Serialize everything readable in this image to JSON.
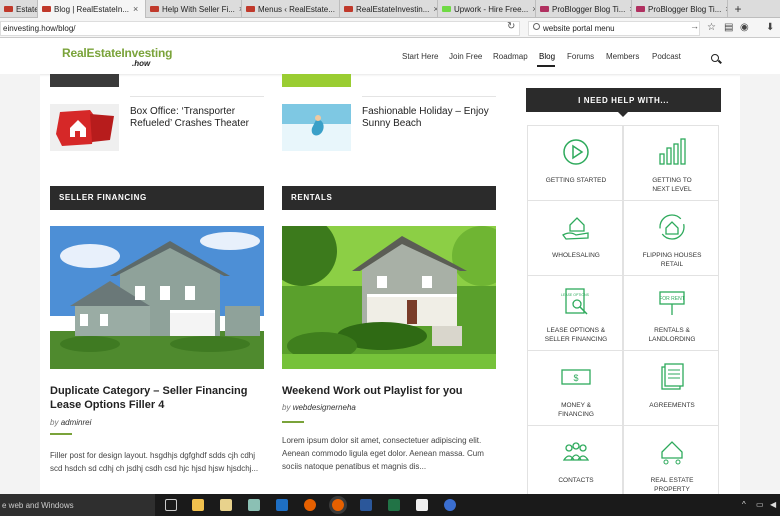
{
  "browser": {
    "tabs": [
      {
        "label": "Estate...",
        "fav": "#c0392b"
      },
      {
        "label": "Blog | RealEstateIn...",
        "fav": "#c0392b",
        "active": true
      },
      {
        "label": "Help With Seller Fi...",
        "fav": "#c0392b"
      },
      {
        "label": "Menus ‹ RealEstate...",
        "fav": "#c0392b"
      },
      {
        "label": "RealEstateInvestin...",
        "fav": "#c0392b"
      },
      {
        "label": "Upwork - Hire Free...",
        "fav": "#6fda44"
      },
      {
        "label": "ProBlogger Blog Ti...",
        "fav": "#b03060"
      },
      {
        "label": "ProBlogger Blog Ti...",
        "fav": "#b03060"
      }
    ],
    "url": "einvesting.how/blog/",
    "search_value": "website portal menu"
  },
  "site": {
    "logo_main": "RealEstateInvesting",
    "logo_sub": ".how",
    "menu": [
      "Start Here",
      "Join Free",
      "Roadmap",
      "Blog",
      "Forums",
      "Members",
      "Podcast"
    ],
    "active_menu": "Blog",
    "brand_color": "#7aa33a"
  },
  "small_posts": [
    {
      "title": "Box Office: ‘Transporter Refueled’ Crashes Theater"
    },
    {
      "title": "Fashionable Holiday – Enjoy Sunny Beach"
    }
  ],
  "sections": [
    {
      "heading": "SELLER FINANCING",
      "post_title": "Duplicate Category – Seller Financing Lease Options Filler 4",
      "by": "by",
      "author": "adminrei",
      "excerpt": "Filler post for design layout.  hsgdhjs dgfghdf sdds cjh cdhj scd hsdch sd cdhj ch jsdhj csdh csd hjc hjsd hjsw hjsdchj..."
    },
    {
      "heading": "RENTALS",
      "post_title": "Weekend Work out Playlist for you",
      "by": "by",
      "author": "webdesignerneha",
      "excerpt": "Lorem ipsum dolor sit amet, consectetuer adipiscing elit. Aenean commodo ligula eget dolor. Aenean massa. Cum sociis natoque penatibus et magnis dis..."
    }
  ],
  "sidebar": {
    "heading": "I NEED HELP WITH...",
    "items": [
      {
        "label": "GETTING STARTED",
        "icon": "play-icon"
      },
      {
        "label": "GETTING TO NEXT LEVEL",
        "icon": "bar-chart-icon"
      },
      {
        "label": "WHOLESALING",
        "icon": "hand-house-icon"
      },
      {
        "label": "FLIPPING HOUSES RETAIL",
        "icon": "house-cycle-icon"
      },
      {
        "label": "LEASE OPTIONS & SELLER FINANCING",
        "icon": "document-search-icon"
      },
      {
        "label": "RENTALS & LANDLORDING",
        "icon": "for-rent-sign-icon"
      },
      {
        "label": "MONEY & FINANCING",
        "icon": "money-icon"
      },
      {
        "label": "AGREEMENTS",
        "icon": "documents-icon"
      },
      {
        "label": "CONTACTS",
        "icon": "people-icon"
      },
      {
        "label": "REAL ESTATE PROPERTY",
        "icon": "house-people-icon"
      }
    ],
    "for_rent_text": "FOR RENT",
    "lease_text": "LEASE OPTIONS"
  },
  "taskbar": {
    "search_text": "e web and Windows"
  }
}
